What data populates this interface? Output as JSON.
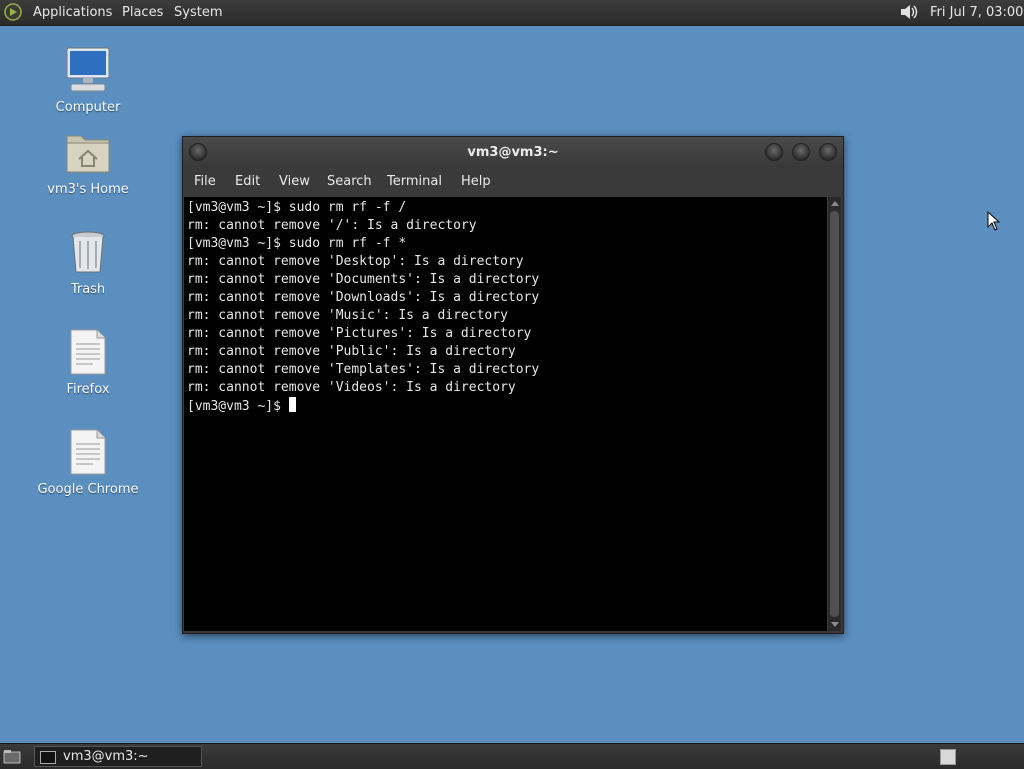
{
  "top_panel": {
    "menus": [
      "Applications",
      "Places",
      "System"
    ],
    "clock": "Fri Jul  7, 03:00",
    "volume_icon": "speaker-icon",
    "logo_icon": "distro-logo-icon"
  },
  "desktop_icons": [
    {
      "label": "Computer",
      "icon": "computer-icon"
    },
    {
      "label": "vm3's Home",
      "icon": "home-folder-icon"
    },
    {
      "label": "Trash",
      "icon": "trash-icon"
    },
    {
      "label": "Firefox",
      "icon": "file-icon"
    },
    {
      "label": "Google Chrome",
      "icon": "file-icon"
    }
  ],
  "terminal": {
    "title": "vm3@vm3:~",
    "menu": [
      "File",
      "Edit",
      "View",
      "Search",
      "Terminal",
      "Help"
    ],
    "lines": [
      "[vm3@vm3 ~]$ sudo rm rf -f /",
      "rm: cannot remove '/': Is a directory",
      "[vm3@vm3 ~]$ sudo rm rf -f *",
      "rm: cannot remove 'Desktop': Is a directory",
      "rm: cannot remove 'Documents': Is a directory",
      "rm: cannot remove 'Downloads': Is a directory",
      "rm: cannot remove 'Music': Is a directory",
      "rm: cannot remove 'Pictures': Is a directory",
      "rm: cannot remove 'Public': Is a directory",
      "rm: cannot remove 'Templates': Is a directory",
      "rm: cannot remove 'Videos': Is a directory"
    ],
    "prompt": "[vm3@vm3 ~]$ "
  },
  "bottom_panel": {
    "task_label": "vm3@vm3:~"
  },
  "colors": {
    "desktop": "#5b8fbf",
    "panel": "#2f2f2f",
    "terminal_bg": "#000000",
    "terminal_fg": "#e6e6e6"
  }
}
